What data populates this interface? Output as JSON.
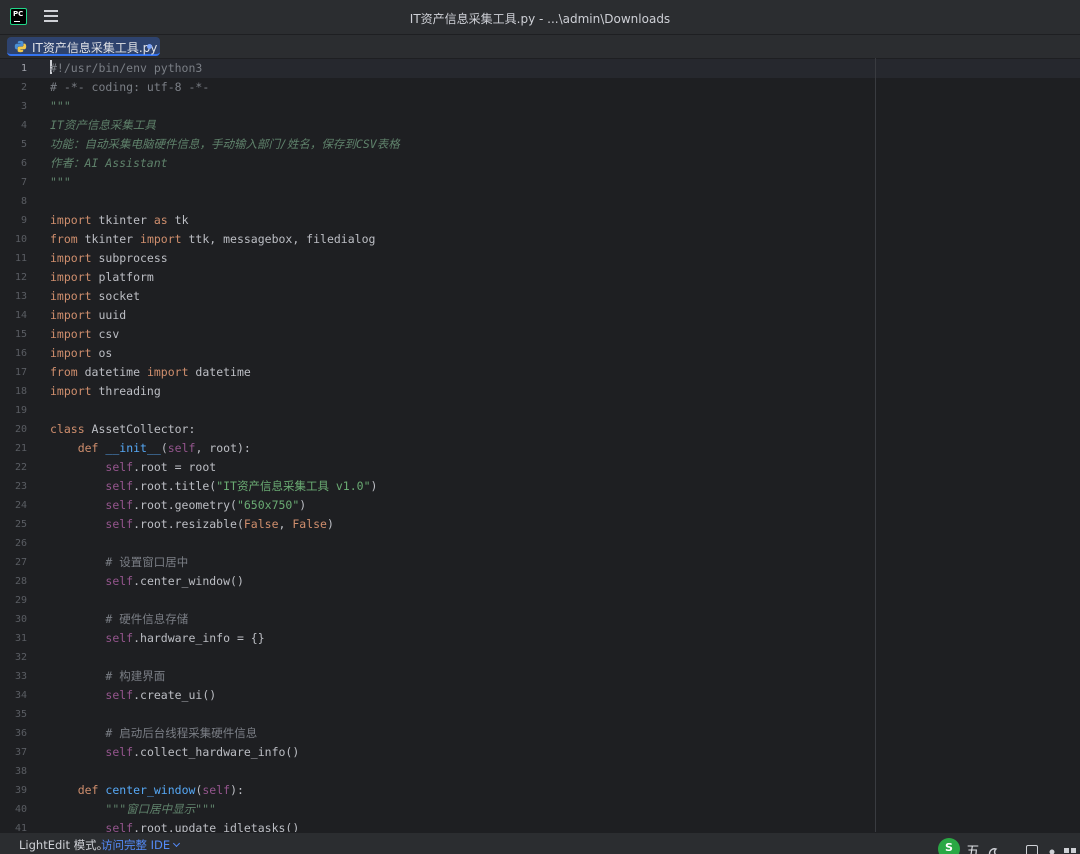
{
  "window": {
    "title": "IT资产信息采集工具.py - ...\\admin\\Downloads"
  },
  "tab": {
    "label": "IT资产信息采集工具.py",
    "icon": "python-file-icon",
    "modified": true
  },
  "editor": {
    "current_line": 1,
    "line_numbers": [
      "1",
      "2",
      "3",
      "4",
      "5",
      "6",
      "7",
      "8",
      "9",
      "10",
      "11",
      "12",
      "13",
      "14",
      "15",
      "16",
      "17",
      "18",
      "19",
      "20",
      "21",
      "22",
      "23",
      "24",
      "25",
      "26",
      "27",
      "28",
      "29",
      "30",
      "31",
      "32",
      "33",
      "34",
      "35",
      "36",
      "37",
      "38",
      "39",
      "40",
      "41"
    ],
    "lines": [
      [
        [
          "#!/usr/bin/env python3",
          "cm"
        ]
      ],
      [
        [
          "# -*- coding: utf-8 -*-",
          "cm"
        ]
      ],
      [
        [
          "\"\"\"",
          "doc"
        ]
      ],
      [
        [
          "IT资产信息采集工具",
          "doc"
        ]
      ],
      [
        [
          "功能：自动采集电脑硬件信息，手动输入部门/姓名，保存到CSV表格",
          "doc"
        ]
      ],
      [
        [
          "作者：AI Assistant",
          "doc"
        ]
      ],
      [
        [
          "\"\"\"",
          "doc"
        ]
      ],
      [],
      [
        [
          "import",
          "kw"
        ],
        [
          " tkinter ",
          ""
        ],
        [
          "as",
          "kw"
        ],
        [
          " tk",
          ""
        ]
      ],
      [
        [
          "from",
          "kw"
        ],
        [
          " tkinter ",
          ""
        ],
        [
          "import",
          "kw"
        ],
        [
          " ttk, messagebox, filedialog",
          ""
        ]
      ],
      [
        [
          "import",
          "kw"
        ],
        [
          " subprocess",
          ""
        ]
      ],
      [
        [
          "import",
          "kw"
        ],
        [
          " platform",
          ""
        ]
      ],
      [
        [
          "import",
          "kw"
        ],
        [
          " socket",
          ""
        ]
      ],
      [
        [
          "import",
          "kw"
        ],
        [
          " uuid",
          ""
        ]
      ],
      [
        [
          "import",
          "kw"
        ],
        [
          " csv",
          ""
        ]
      ],
      [
        [
          "import",
          "kw"
        ],
        [
          " os",
          ""
        ]
      ],
      [
        [
          "from",
          "kw"
        ],
        [
          " datetime ",
          ""
        ],
        [
          "import",
          "kw"
        ],
        [
          " datetime",
          ""
        ]
      ],
      [
        [
          "import",
          "kw"
        ],
        [
          " threading",
          ""
        ]
      ],
      [],
      [
        [
          "class",
          "kw"
        ],
        [
          " AssetCollector:",
          ""
        ]
      ],
      [
        [
          "    ",
          ""
        ],
        [
          "def",
          "kw"
        ],
        [
          " ",
          ""
        ],
        [
          "__init__",
          "fn"
        ],
        [
          "(",
          ""
        ],
        [
          "self",
          "self"
        ],
        [
          ", root):",
          ""
        ]
      ],
      [
        [
          "        ",
          ""
        ],
        [
          "self",
          "self"
        ],
        [
          ".root = root",
          ""
        ]
      ],
      [
        [
          "        ",
          ""
        ],
        [
          "self",
          "self"
        ],
        [
          ".root.title(",
          ""
        ],
        [
          "\"IT资产信息采集工具 v1.0\"",
          "st"
        ],
        [
          ")",
          ""
        ]
      ],
      [
        [
          "        ",
          ""
        ],
        [
          "self",
          "self"
        ],
        [
          ".root.geometry(",
          ""
        ],
        [
          "\"650x750\"",
          "st"
        ],
        [
          ")",
          ""
        ]
      ],
      [
        [
          "        ",
          ""
        ],
        [
          "self",
          "self"
        ],
        [
          ".root.resizable(",
          ""
        ],
        [
          "False",
          "kw"
        ],
        [
          ", ",
          ""
        ],
        [
          "False",
          "kw"
        ],
        [
          ")",
          ""
        ]
      ],
      [],
      [
        [
          "        # 设置窗口居中",
          "cm"
        ]
      ],
      [
        [
          "        ",
          ""
        ],
        [
          "self",
          "self"
        ],
        [
          ".center_window()",
          ""
        ]
      ],
      [],
      [
        [
          "        # 硬件信息存储",
          "cm"
        ]
      ],
      [
        [
          "        ",
          ""
        ],
        [
          "self",
          "self"
        ],
        [
          ".hardware_info = {}",
          ""
        ]
      ],
      [],
      [
        [
          "        # 构建界面",
          "cm"
        ]
      ],
      [
        [
          "        ",
          ""
        ],
        [
          "self",
          "self"
        ],
        [
          ".create_ui()",
          ""
        ]
      ],
      [],
      [
        [
          "        # 启动后台线程采集硬件信息",
          "cm"
        ]
      ],
      [
        [
          "        ",
          ""
        ],
        [
          "self",
          "self"
        ],
        [
          ".collect_hardware_info()",
          ""
        ]
      ],
      [],
      [
        [
          "    ",
          ""
        ],
        [
          "def",
          "kw"
        ],
        [
          " ",
          ""
        ],
        [
          "center_window",
          "fn"
        ],
        [
          "(",
          ""
        ],
        [
          "self",
          "self"
        ],
        [
          "):",
          ""
        ]
      ],
      [
        [
          "        ",
          ""
        ],
        [
          "\"\"\"窗口居中显示\"\"\"",
          "doc"
        ]
      ],
      [
        [
          "        ",
          ""
        ],
        [
          "self",
          "self"
        ],
        [
          ".root.update_idletasks()",
          ""
        ]
      ]
    ]
  },
  "status": {
    "mode": "LightEdit 模式。",
    "ide_link": "访问完整 IDE",
    "ime_label": "五"
  },
  "colors": {
    "background": "#1e1f22",
    "panel": "#2b2d30",
    "keyword": "#cf8e6d",
    "string": "#6aab73",
    "docstring": "#5f826b",
    "comment": "#7a7e85",
    "self": "#94558d",
    "accent": "#3574f0"
  }
}
